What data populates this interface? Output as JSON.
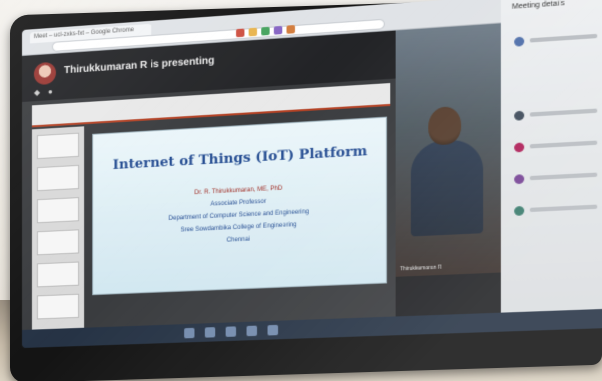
{
  "browser": {
    "tab_title": "Meet – ucl-zxks-fxt – Google Chrome"
  },
  "meeting": {
    "presenter_banner": "Thirukkumaran R is presenting"
  },
  "side_panel": {
    "title": "Meeting details"
  },
  "slide": {
    "title": "Internet of Things (IoT) Platform",
    "speaker": "Dr. R. Thirukkumaran, ME, PhD",
    "role": "Associate Professor",
    "department": "Department of Computer Science and Engineering",
    "college": "Sree Sowdambika College of Engineering",
    "location": "Chennai"
  },
  "video": {
    "participant_name": "Thirukkumaran R"
  },
  "colors": {
    "slide_title": "#1f4fa0",
    "slide_accent": "#b02a1f",
    "meet_dark": "#232427",
    "taskbar": "#243348"
  }
}
